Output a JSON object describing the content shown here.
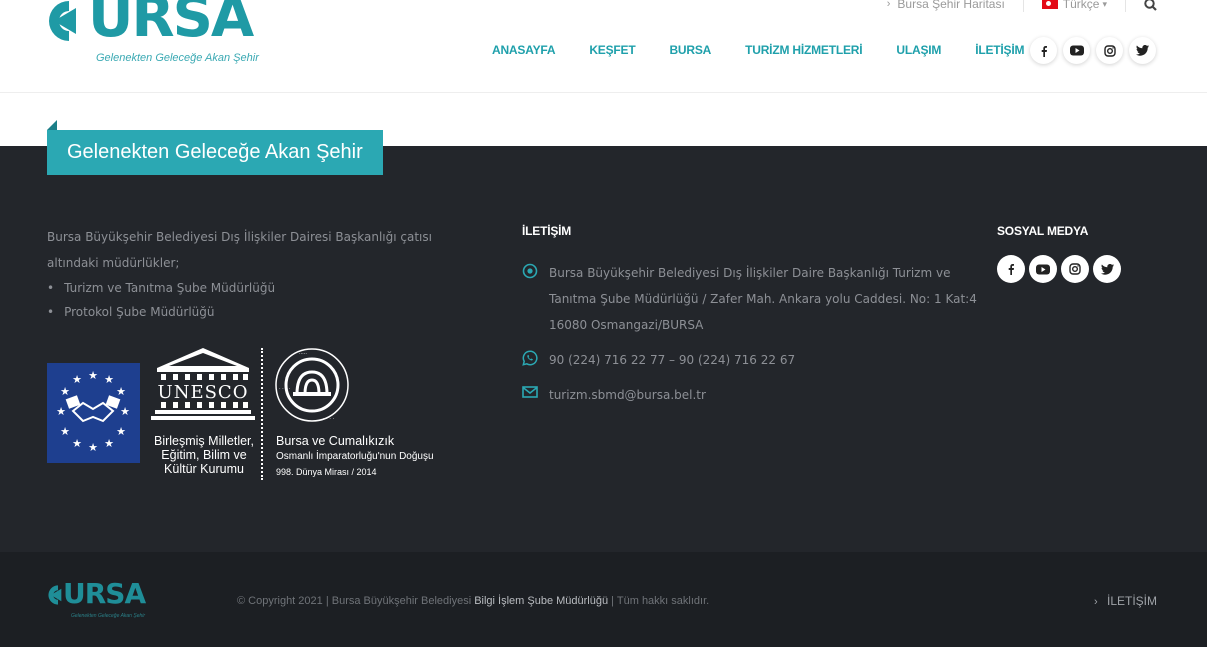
{
  "header": {
    "logo": {
      "word": "URSA",
      "tagline": "Gelenekten Geleceğe Akan Şehir"
    },
    "topbar": {
      "city_map": "Bursa Şehir Haritası",
      "language": "Türkçe"
    },
    "nav": [
      "ANASAYFA",
      "KEŞFET",
      "BURSA",
      "TURİZM HİZMETLERİ",
      "ULAŞIM",
      "İLETİŞİM"
    ],
    "social_icons": [
      "facebook-icon",
      "youtube-icon",
      "instagram-icon",
      "twitter-icon"
    ]
  },
  "banner": {
    "text": "Gelenekten Geleceğe Akan Şehir"
  },
  "footer": {
    "about": {
      "intro": "Bursa Büyükşehir Belediyesi Dış İlişkiler Dairesi Başkanlığı çatısı altındaki müdürlükler;",
      "items": [
        "Turizm ve Tanıtma Şube Müdürlüğü",
        "Protokol Şube Müdürlüğü"
      ]
    },
    "logos": {
      "unesco_word": "UNESCO",
      "unesco_caption": [
        "Birleşmiş Milletler,",
        "Eğitim, Bilim ve",
        "Kültür Kurumu"
      ],
      "heritage_line1": "Bursa ve Cumalıkızık",
      "heritage_line2": "Osmanlı İmparatorluğu'nun Doğuşu",
      "heritage_line3": "998. Dünya Mirası / 2014"
    },
    "contact": {
      "title": "İLETİŞİM",
      "address": "Bursa Büyükşehir Belediyesi Dış İlişkiler Daire Başkanlığı Turizm ve Tanıtma Şube Müdürlüğü / Zafer Mah. Ankara yolu Caddesi. No: 1 Kat:4 16080 Osmangazi/BURSA",
      "phone": "90 (224) 716 22 77 – 90 (224) 716 22 67",
      "email": "turizm.sbmd@bursa.bel.tr"
    },
    "social": {
      "title": "SOSYAL MEDYA"
    }
  },
  "bottom": {
    "logo_word": "URSA",
    "logo_tagline": "Gelenekten Geleceğe Akan Şehir",
    "copyright_prefix": "© Copyright 2021 | Bursa Büyükşehir Belediyesi",
    "copyright_highlight": "Bilgi İşlem Şube Müdürlüğü",
    "copyright_suffix": "| Tüm hakkı saklıdır.",
    "link": "İLETİŞİM"
  },
  "colors": {
    "brand": "#1f9aa5",
    "banner": "#2ba8b3",
    "footer_bg": "#23262b",
    "bottom_bg": "#1c1f23"
  }
}
